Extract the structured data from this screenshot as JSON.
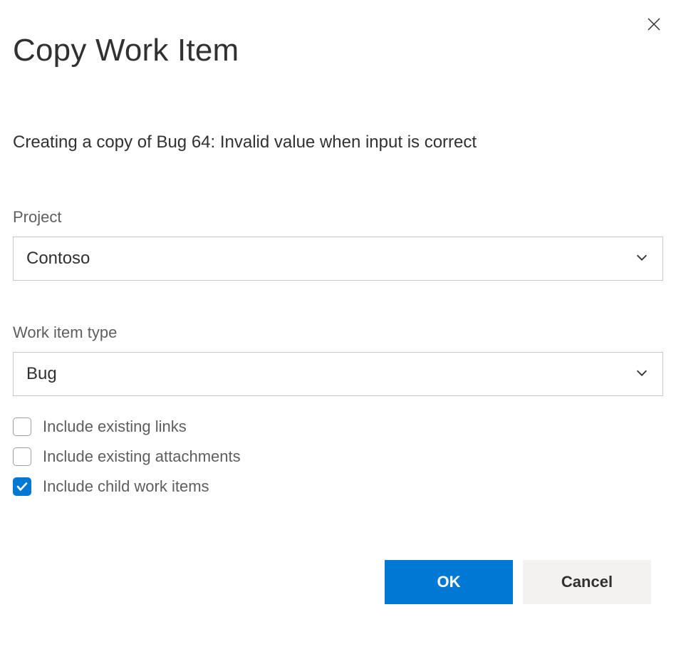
{
  "dialog": {
    "title": "Copy Work Item",
    "description": "Creating a copy of Bug 64: Invalid value when input is correct"
  },
  "fields": {
    "project": {
      "label": "Project",
      "value": "Contoso"
    },
    "workItemType": {
      "label": "Work item type",
      "value": "Bug"
    }
  },
  "checkboxes": {
    "includeLinks": {
      "label": "Include existing links",
      "checked": false
    },
    "includeAttachments": {
      "label": "Include existing attachments",
      "checked": false
    },
    "includeChildren": {
      "label": "Include child work items",
      "checked": true
    }
  },
  "buttons": {
    "ok": "OK",
    "cancel": "Cancel"
  }
}
